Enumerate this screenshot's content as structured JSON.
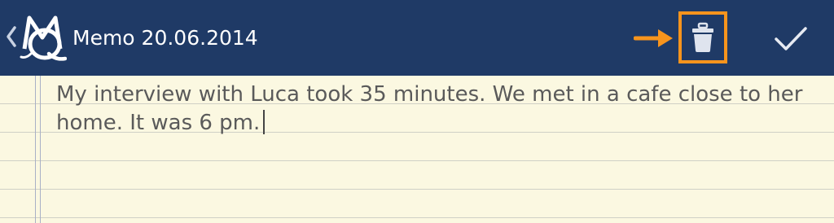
{
  "action_bar": {
    "title": "Memo 20.06.2014",
    "background_color": "#1f3a66",
    "back_icon": "chevron-left-icon",
    "logo_icon": "mq-monogram-logo",
    "delete_icon": "trash-can-icon",
    "done_icon": "checkmark-icon"
  },
  "annotation": {
    "arrow_icon": "arrow-right-icon",
    "highlight_color": "#f7941d"
  },
  "memo": {
    "text": "My interview with Luca took 35 minutes. We met in a cafe close to her home. It was 6 pm.",
    "paper_color": "#fbf8e1",
    "text_color": "#5a5a5a"
  }
}
